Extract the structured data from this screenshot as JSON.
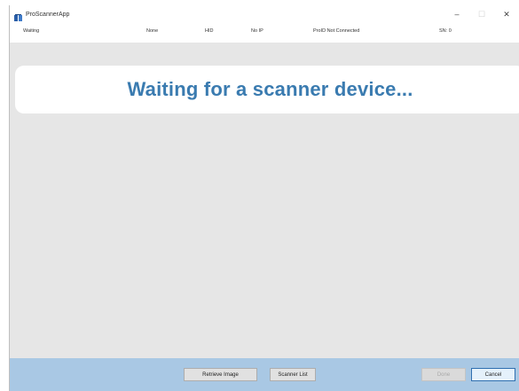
{
  "window": {
    "title": "ProScannerApp",
    "controls": {
      "minimize": "–",
      "maximize": "☐",
      "close": "✕"
    }
  },
  "status": {
    "state": "Waiting",
    "name": "None",
    "id": "HID",
    "ip": "No IP",
    "connection": "ProID Not Connected",
    "sn": "SN: 0"
  },
  "banner": {
    "message": "Waiting for a scanner device..."
  },
  "buttons": {
    "retrieve_image": "Retrieve Image",
    "scanner_list": "Scanner List",
    "done": "Done",
    "cancel": "Cancel"
  },
  "colors": {
    "accent": "#3a7bb0",
    "bottom_bar": "#a9c8e4",
    "body": "#e6e6e6"
  }
}
